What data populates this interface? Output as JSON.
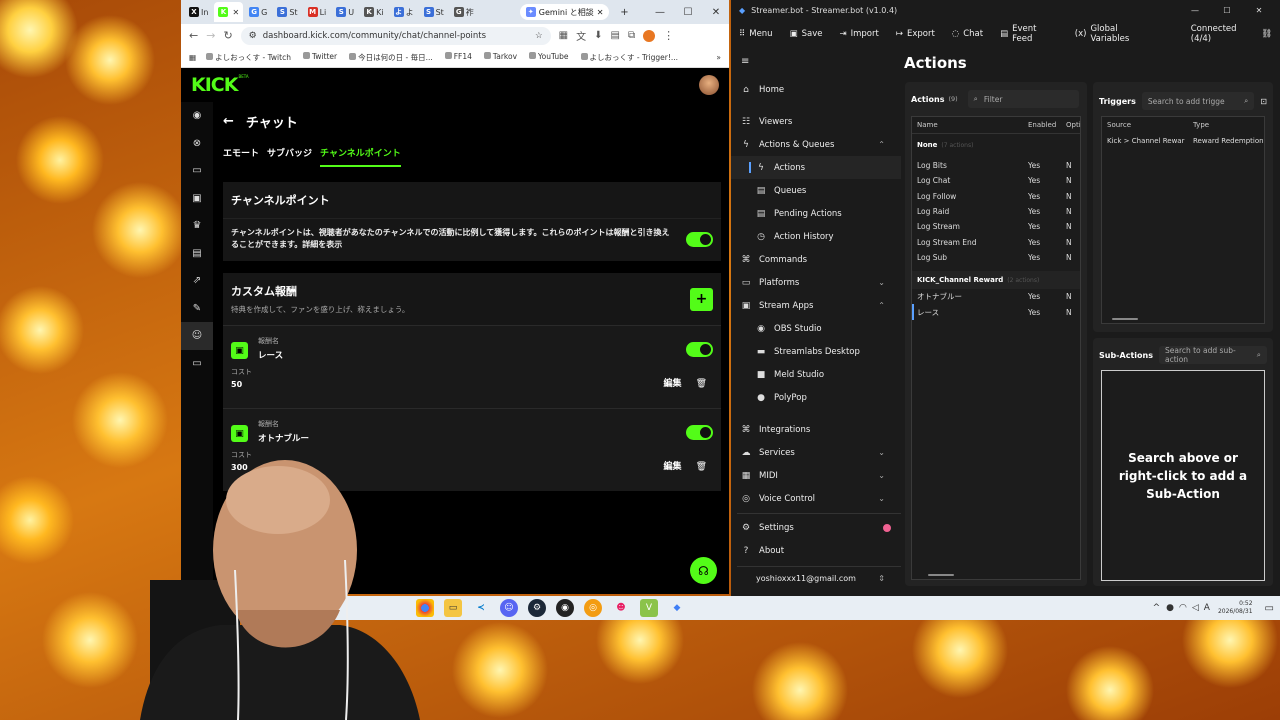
{
  "browser": {
    "tabs": [
      {
        "fav": "X",
        "label": "In",
        "color": "#111"
      },
      {
        "fav": "K",
        "label": "",
        "color": "#53fc18",
        "active": true
      },
      {
        "fav": "G",
        "label": "G",
        "color": "#4285f4"
      },
      {
        "fav": "S",
        "label": "St",
        "color": "#3b6fd8"
      },
      {
        "fav": "M",
        "label": "Li",
        "color": "#d93025"
      },
      {
        "fav": "S",
        "label": "U",
        "color": "#3b6fd8"
      },
      {
        "fav": "K",
        "label": "Ki",
        "color": "#555"
      },
      {
        "fav": "よ",
        "label": "よ",
        "color": "#3b6fd8"
      },
      {
        "fav": "S",
        "label": "St",
        "color": "#3b6fd8"
      },
      {
        "fav": "G",
        "label": "祚",
        "color": "#555"
      }
    ],
    "gemini_tab": "Gemini と相談",
    "url": "dashboard.kick.com/community/chat/channel-points",
    "bookmarks": [
      "よしおっくす - Twitch",
      "Twitter",
      "今日は何の日 - 毎日...",
      "FF14",
      "Tarkov",
      "YouTube",
      "よしおっくす - Trigger!..."
    ]
  },
  "kick": {
    "logo": "KICK",
    "beta": "BETA",
    "header_title": "チャット",
    "tabs": [
      "エモート",
      "サブバッジ",
      "チャンネルポイント"
    ],
    "active_tab": 2,
    "channel_points_title": "チャンネルポイント",
    "channel_points_desc": "チャンネルポイントは、視聴者があなたのチャンネルでの活動に比例して獲得します。これらのポイントは報酬と引き換えることができます。詳細を表示",
    "custom_rewards_title": "カスタム報酬",
    "custom_rewards_desc": "特典を作成して、ファンを盛り上げ、称えましょう。",
    "rewards": [
      {
        "name_label": "報酬名",
        "name": "レース",
        "cost_label": "コスト",
        "cost": "50",
        "edit": "編集"
      },
      {
        "name_label": "報酬名",
        "name": "オトナブルー",
        "cost_label": "コスト",
        "cost": "300",
        "edit": "編集"
      }
    ]
  },
  "streamerbot": {
    "window_title": "Streamer.bot - Streamer.bot (v1.0.4)",
    "menu": [
      "Menu",
      "Save",
      "Import",
      "Export",
      "Chat",
      "Event Feed",
      "Global Variables"
    ],
    "connected": "Connected (4/4)",
    "nav": [
      {
        "label": "Home",
        "icon": "⌂",
        "level": 0
      },
      {
        "label": "Viewers",
        "icon": "☷",
        "level": 0
      },
      {
        "label": "Actions & Queues",
        "icon": "ϟ",
        "level": 0,
        "chev": "^"
      },
      {
        "label": "Actions",
        "icon": "ϟ",
        "level": 1,
        "active": true
      },
      {
        "label": "Queues",
        "icon": "▤",
        "level": 1
      },
      {
        "label": "Pending Actions",
        "icon": "▤",
        "level": 1
      },
      {
        "label": "Action History",
        "icon": "◷",
        "level": 1
      },
      {
        "label": "Commands",
        "icon": "⌘",
        "level": 0
      },
      {
        "label": "Platforms",
        "icon": "▭",
        "level": 0,
        "chev": "v"
      },
      {
        "label": "Stream Apps",
        "icon": "▣",
        "level": 0,
        "chev": "^"
      },
      {
        "label": "OBS Studio",
        "icon": "◉",
        "level": 1
      },
      {
        "label": "Streamlabs Desktop",
        "icon": "▬",
        "level": 1
      },
      {
        "label": "Meld Studio",
        "icon": "■",
        "level": 1
      },
      {
        "label": "PolyPop",
        "icon": "●",
        "level": 1
      }
    ],
    "nav2": [
      {
        "label": "Integrations",
        "icon": "⌘",
        "chev": ""
      },
      {
        "label": "Services",
        "icon": "☁",
        "chev": "v"
      },
      {
        "label": "MIDI",
        "icon": "▦",
        "chev": "v"
      },
      {
        "label": "Voice Control",
        "icon": "◎",
        "chev": "v"
      }
    ],
    "settings": "Settings",
    "about": "About",
    "account": "yoshioxxx11@gmail.com",
    "page_title": "Actions",
    "actions_header": "Actions",
    "actions_count": "(9)",
    "filter_placeholder": "Filter",
    "columns": [
      "Name",
      "Enabled",
      "Opti"
    ],
    "groups": [
      {
        "name": "None",
        "count": "(7 actions)",
        "rows": [
          {
            "name": "Log Bits",
            "enabled": "Yes",
            "opt": "N"
          },
          {
            "name": "Log Chat",
            "enabled": "Yes",
            "opt": "N"
          },
          {
            "name": "Log Follow",
            "enabled": "Yes",
            "opt": "N"
          },
          {
            "name": "Log Raid",
            "enabled": "Yes",
            "opt": "N"
          },
          {
            "name": "Log Stream",
            "enabled": "Yes",
            "opt": "N"
          },
          {
            "name": "Log Stream End",
            "enabled": "Yes",
            "opt": "N"
          },
          {
            "name": "Log Sub",
            "enabled": "Yes",
            "opt": "N"
          }
        ]
      },
      {
        "name": "KICK_Channel Reward",
        "count": "(2 actions)",
        "rows": [
          {
            "name": "オトナブルー",
            "enabled": "Yes",
            "opt": "N"
          },
          {
            "name": "レース",
            "enabled": "Yes",
            "opt": "N"
          }
        ]
      }
    ],
    "triggers_title": "Triggers",
    "triggers_placeholder": "Search to add trigge",
    "trigger_columns": [
      "Source",
      "Type"
    ],
    "trigger_rows": [
      {
        "source": "Kick > Channel Rewar",
        "type": "Reward Redemption"
      }
    ],
    "subactions_title": "Sub-Actions",
    "subactions_placeholder": "Search to add sub-action",
    "subactions_empty": "Search above or right-click to add a Sub-Action"
  },
  "taskbar": {
    "clock_time": "0:52",
    "clock_date": "2026/08/31"
  }
}
